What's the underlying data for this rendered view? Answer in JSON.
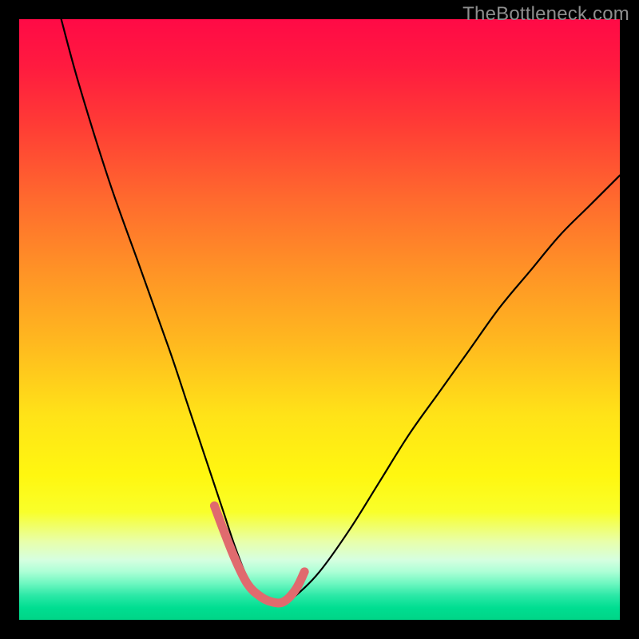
{
  "watermark": {
    "text": "TheBottleneck.com"
  },
  "colors": {
    "background": "#000000",
    "curve_main": "#000000",
    "curve_highlight": "#e06a6e"
  },
  "chart_data": {
    "type": "line",
    "title": "",
    "xlabel": "",
    "ylabel": "",
    "xlim": [
      0,
      100
    ],
    "ylim": [
      0,
      100
    ],
    "grid": false,
    "legend": false,
    "annotations": [],
    "series": [
      {
        "name": "main-curve",
        "x": [
          7,
          10,
          15,
          20,
          25,
          28,
          30,
          32,
          34,
          36,
          38,
          40,
          42,
          44,
          46,
          50,
          55,
          60,
          65,
          70,
          75,
          80,
          85,
          90,
          95,
          100
        ],
        "values": [
          100,
          89,
          73,
          59,
          45,
          36,
          30,
          24,
          18,
          12,
          7,
          4,
          3,
          3,
          4,
          8,
          15,
          23,
          31,
          38,
          45,
          52,
          58,
          64,
          69,
          74
        ]
      },
      {
        "name": "highlight-segment",
        "x": [
          32.5,
          34,
          36,
          38,
          40,
          42,
          44,
          46,
          47.5
        ],
        "values": [
          19,
          15,
          10,
          6,
          4,
          3,
          3,
          5,
          8
        ]
      }
    ]
  }
}
